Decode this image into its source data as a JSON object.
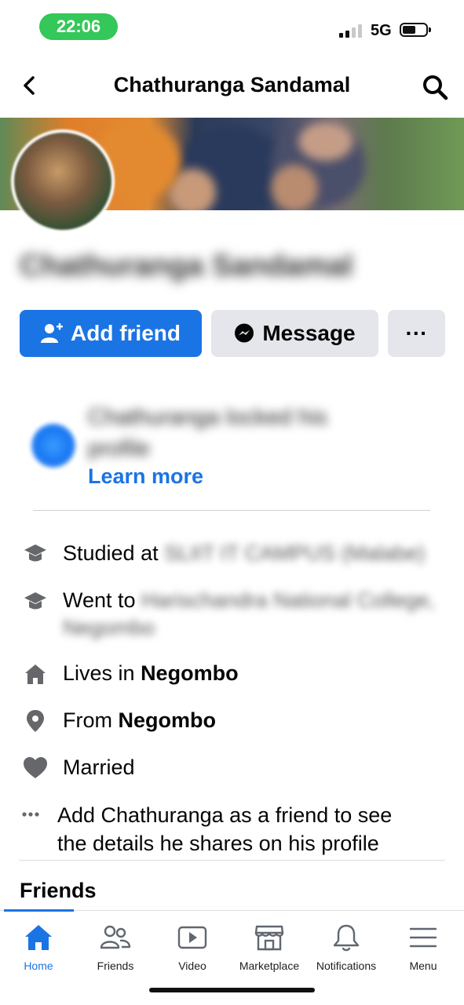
{
  "status_bar": {
    "time": "22:06",
    "network": "5G"
  },
  "header": {
    "title": "Chathuranga Sandamal"
  },
  "profile": {
    "name": "Chathuranga Sandamal"
  },
  "actions": {
    "add_friend": "Add friend",
    "message": "Message",
    "more": "···"
  },
  "notice": {
    "text": "Chathuranga locked his profile",
    "link": "Learn more"
  },
  "details": [
    {
      "prefix": "Studied at",
      "value": "SLIIT IT CAMPUS (Malabe)"
    },
    {
      "prefix": "Went to",
      "value": "Harischandra National College, Negombo"
    },
    {
      "prefix": "Lives in",
      "value": "Negombo"
    },
    {
      "prefix": "From",
      "value": "Negombo"
    },
    {
      "prefix": "Married",
      "value": ""
    }
  ],
  "privacy_note": "Add Chathuranga as a friend to see the details he shares on his profile",
  "sections": {
    "friends": "Friends"
  },
  "tabs": [
    {
      "label": "Home",
      "icon": "home-icon",
      "active": true
    },
    {
      "label": "Friends",
      "icon": "friends-icon",
      "active": false
    },
    {
      "label": "Video",
      "icon": "video-icon",
      "active": false
    },
    {
      "label": "Marketplace",
      "icon": "marketplace-icon",
      "active": false
    },
    {
      "label": "Notifications",
      "icon": "bell-icon",
      "active": false
    },
    {
      "label": "Menu",
      "icon": "menu-icon",
      "active": false
    }
  ],
  "colors": {
    "accent": "#1b74e4",
    "button_grey": "#e4e6eb",
    "status_pill": "#34c759"
  }
}
